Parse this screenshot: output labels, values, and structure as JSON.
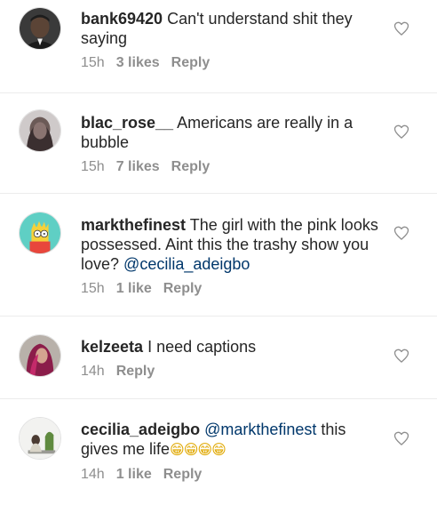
{
  "comments": [
    {
      "username": "bank69420",
      "text": "Can't understand shit they saying",
      "time": "15h",
      "likes": "3 likes",
      "reply": "Reply"
    },
    {
      "username": "blac_rose__",
      "text": "Americans are really in a bubble",
      "time": "15h",
      "likes": "7 likes",
      "reply": "Reply"
    },
    {
      "username": "markthefinest",
      "text": "The girl with the pink looks possessed. Aint this the trashy show you love?",
      "mention": "@cecilia_adeigbo",
      "time": "15h",
      "likes": "1 like",
      "reply": "Reply"
    },
    {
      "username": "kelzeeta",
      "text": "I need captions",
      "time": "14h",
      "reply": "Reply"
    },
    {
      "username": "cecilia_adeigbo",
      "mention": "@markthefinest",
      "text": "this gives me life",
      "emoji": "😁😁😁😁",
      "time": "14h",
      "likes": "1 like",
      "reply": "Reply"
    }
  ],
  "icons": {
    "like": "heart-outline-icon"
  },
  "colors": {
    "text": "#262626",
    "meta": "#8e8e8e",
    "mention": "#00376b",
    "divider": "#ececec"
  }
}
